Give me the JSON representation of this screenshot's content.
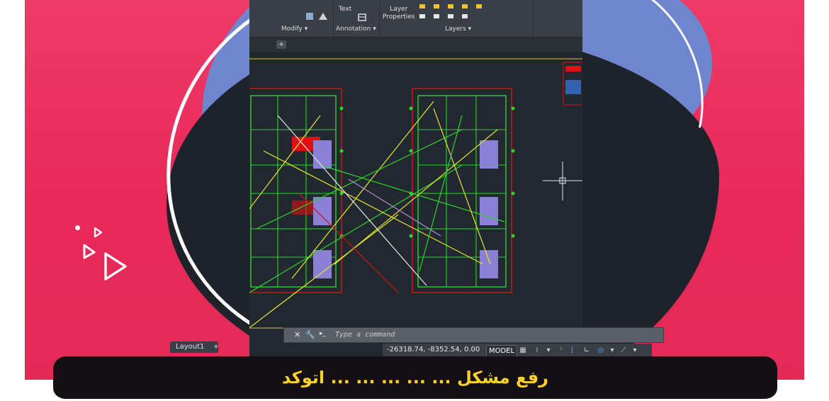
{
  "ribbon": {
    "modify_label": "Modify",
    "annotation_label": "Annotation",
    "layers_label": "Layers",
    "text_label": "Text",
    "layer_properties_label": "Layer\nProperties"
  },
  "drawing": {
    "cursor": "crosshair"
  },
  "command": {
    "placeholder": "Type a command"
  },
  "statusbar": {
    "coordinates": "-26318.74, -8352.54, 0.00",
    "model_label": "MODEL"
  },
  "tabs": {
    "layout_label": "Layout1"
  },
  "banner": {
    "text": "رفع مشکل ... ... ... ... ... اتوکد"
  },
  "colors": {
    "background_pink": "#e8295a",
    "blob_blue": "#6f86cf",
    "canvas_dark": "#212830",
    "banner_yellow": "#ffd02a"
  }
}
